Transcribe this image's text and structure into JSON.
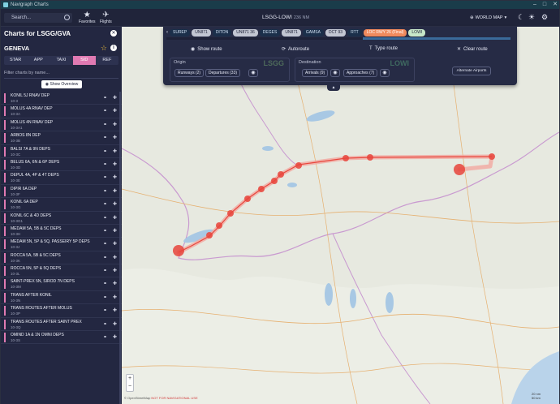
{
  "window": {
    "title": "Navigraph Charts",
    "controls": [
      "–",
      "□",
      "✕"
    ]
  },
  "topbar": {
    "search_placeholder": "Search...",
    "favorites_label": "Favorites",
    "flights_label": "Flights",
    "route_title": "LSGG-LOWI",
    "route_distance": "236 NM",
    "world_map_label": "WORLD MAP"
  },
  "sidebar": {
    "header": "Charts for LSGG/GVA",
    "airport": "GENEVA",
    "tabs": [
      {
        "label": "STAR",
        "active": false
      },
      {
        "label": "APP",
        "active": false
      },
      {
        "label": "TAXI",
        "active": false
      },
      {
        "label": "SID",
        "active": true
      },
      {
        "label": "REF",
        "active": false
      }
    ],
    "filter_placeholder": "Filter charts by name...",
    "overview_button": "Show Overview",
    "charts": [
      {
        "name": "KONIL 5J RNAV DEP",
        "code": "10-3"
      },
      {
        "name": "MOLUS 4A RNAV DEP",
        "code": "10-3A"
      },
      {
        "name": "MOLUS 4N RNAV DEP",
        "code": "10-3A1"
      },
      {
        "name": "ARBOS 8N DEP",
        "code": "10-3B"
      },
      {
        "name": "BALSI 7A & 9N DEPS",
        "code": "10-3C"
      },
      {
        "name": "BELUS 6A, 6N & 6P DEPS",
        "code": "10-3D"
      },
      {
        "name": "DEPUL 4A, 4P & 4T DEPS",
        "code": "10-3E"
      },
      {
        "name": "DIPIR 6A DEP",
        "code": "10-3F"
      },
      {
        "name": "KONIL 6A DEP",
        "code": "10-3G"
      },
      {
        "name": "KONIL 6C & 4D DEPS",
        "code": "10-3G1"
      },
      {
        "name": "MEDAM 5A, 5B & 5C DEPS",
        "code": "10-3H"
      },
      {
        "name": "MEDAM 5N, 5P & 5Q, PASSEIRY 5P DEPS",
        "code": "10-3J"
      },
      {
        "name": "ROCCA 5A, 5B & 5C DEPS",
        "code": "10-3K"
      },
      {
        "name": "ROCCA 5N, 5P & 5Q DEPS",
        "code": "10-3L"
      },
      {
        "name": "SAINT-PREX 5N, SIROD 7N DEPS",
        "code": "10-3M"
      },
      {
        "name": "TRANS AFTER KONIL",
        "code": "10-3N"
      },
      {
        "name": "TRANS ROUTES AFTER MOLUS",
        "code": "10-3P"
      },
      {
        "name": "TRANS ROUTES AFTER SAINT PREX",
        "code": "10-3Q"
      },
      {
        "name": "OMIND 1A & 1N OMNI DEPS",
        "code": "10-3S"
      }
    ]
  },
  "route_panel": {
    "chips": [
      {
        "label": "SUREP",
        "style": "blue"
      },
      {
        "label": "UN871",
        "style": "g"
      },
      {
        "label": "DITON",
        "style": "blue"
      },
      {
        "label": "UN871 36",
        "style": "g"
      },
      {
        "label": "DEGES",
        "style": "blue"
      },
      {
        "label": "UN871",
        "style": "g"
      },
      {
        "label": "GAMSA",
        "style": "blue"
      },
      {
        "label": "DCT 93",
        "style": "g"
      },
      {
        "label": "RTT",
        "style": "blue"
      },
      {
        "label": "LOC RWY 26 (Final)",
        "style": "orange"
      },
      {
        "label": "LOWI",
        "style": "green"
      }
    ],
    "show_route": "Show route",
    "autoroute": "Autoroute",
    "type_route": "Type route",
    "clear_route": "Clear route",
    "origin_label": "Origin",
    "origin_code": "LSGG",
    "origin_runways": "Runways (2)",
    "origin_departures": "Departures (33)",
    "destination_label": "Destination",
    "destination_code": "LOWI",
    "dest_arrivals": "Arrivals (9)",
    "dest_approaches": "Approaches (7)",
    "alternate_button": "Alternate Airports",
    "collapse_icon": "chevron-up-icon"
  },
  "map": {
    "attribution": "© OpenStreetMap",
    "warning": "NOT FOR NAVIGATIONAL USE",
    "scale_top": "20 nm",
    "scale_bottom": "50 km",
    "route_color": "#e8453c"
  }
}
